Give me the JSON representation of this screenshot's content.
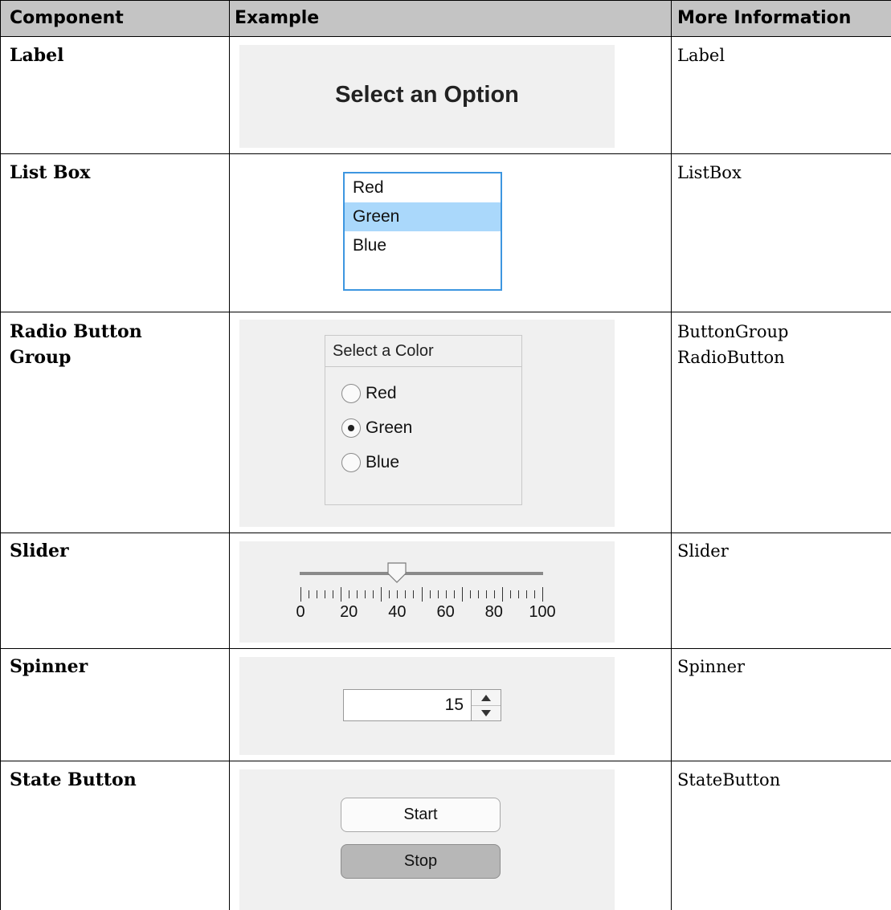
{
  "header": {
    "col_component": "Component",
    "col_example": "Example",
    "col_more_info": "More Information"
  },
  "rows": [
    {
      "component": "Label",
      "info": [
        "Label"
      ],
      "example_text": "Select an Option"
    },
    {
      "component": "List Box",
      "info": [
        "ListBox"
      ],
      "items": [
        "Red",
        "Green",
        "Blue"
      ],
      "selected": "Green"
    },
    {
      "component": [
        "Radio Button",
        "Group"
      ],
      "info": [
        "ButtonGroup",
        "RadioButton"
      ],
      "group_title": "Select a Color",
      "options": [
        "Red",
        "Green",
        "Blue"
      ],
      "selected": "Green"
    },
    {
      "component": "Slider",
      "info": [
        "Slider"
      ],
      "tick_labels": [
        "0",
        "20",
        "40",
        "60",
        "80",
        "100"
      ],
      "value": 40
    },
    {
      "component": "Spinner",
      "info": [
        "Spinner"
      ],
      "value": "15"
    },
    {
      "component": "State Button",
      "info": [
        "StateButton"
      ],
      "buttons": [
        "Start",
        "Stop"
      ],
      "pressed": "Stop"
    }
  ],
  "colors": {
    "header_bg": "#c4c4c4",
    "example_bg": "#f0f0f0",
    "listbox_border": "#3d96e0",
    "listbox_selection": "#aad8fb",
    "stop_button_bg": "#b7b7b7"
  },
  "icons": {
    "spinner_up": "triangle-up-icon",
    "spinner_down": "triangle-down-icon",
    "slider_thumb": "slider-thumb-icon"
  }
}
